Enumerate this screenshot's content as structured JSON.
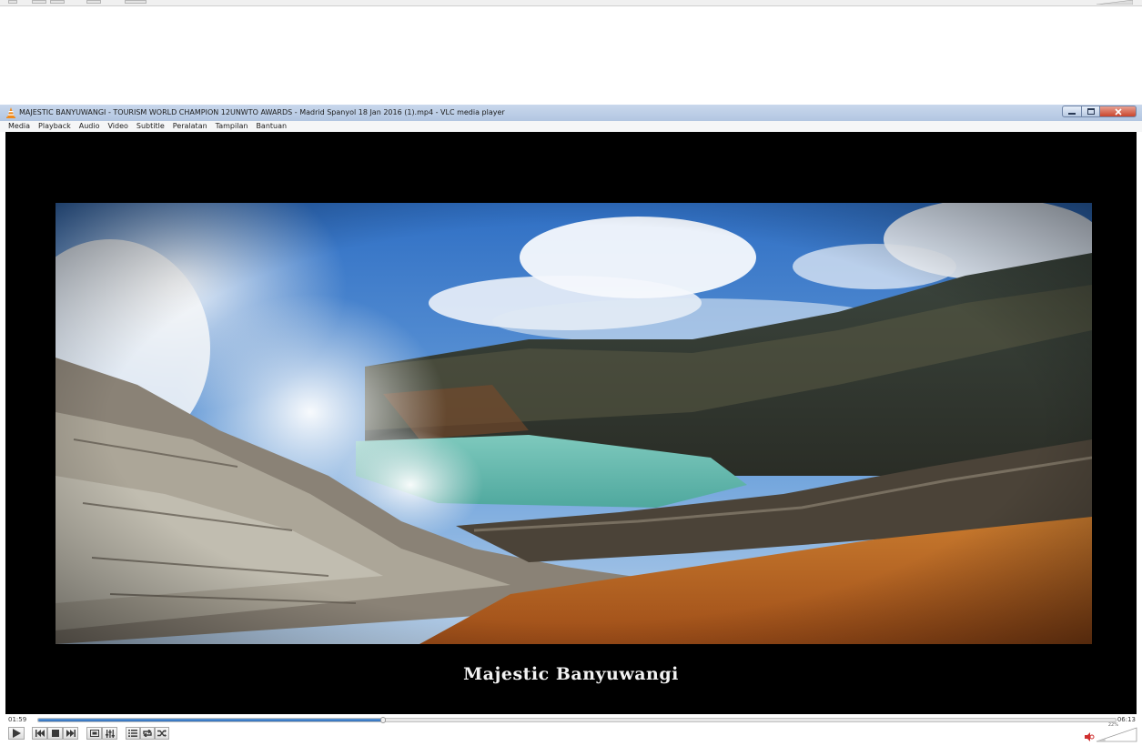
{
  "player": {
    "title": "MAJESTIC BANYUWANGI - TOURISM WORLD CHAMPION  12UNWTO AWARDS - Madrid  Spanyol  18 Jan 2016 (1).mp4 - VLC media player",
    "menu": [
      "Media",
      "Playback",
      "Audio",
      "Video",
      "Subtitle",
      "Peralatan",
      "Tampilan",
      "Bantuan"
    ],
    "subtitle_text": "Majestic Banyuwangi",
    "time_elapsed": "01:59",
    "time_total": "06:13",
    "seek_fraction": 0.32,
    "volume_label": "22%",
    "volume_fraction": 0.22,
    "window_buttons": [
      "minimize-icon",
      "maximize-icon",
      "close-icon"
    ],
    "controls": [
      "play-icon",
      "previous-icon",
      "stop-icon",
      "next-icon",
      "fullscreen-icon",
      "extended-settings-icon",
      "playlist-icon",
      "loop-icon",
      "shuffle-icon"
    ]
  },
  "colors": {
    "accent": "#2d6bb8",
    "titlebar": "#b2c6e1",
    "close": "#c9442b",
    "video_bg": "#000000",
    "watermark": "#d9d9d9"
  }
}
